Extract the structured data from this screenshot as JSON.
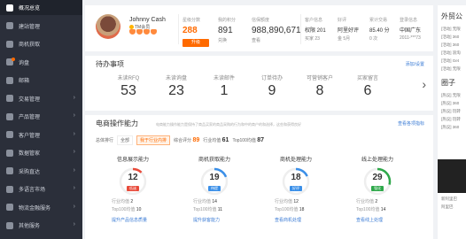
{
  "sidebar": {
    "items": [
      {
        "label": "概况总览",
        "active": true,
        "arrow": false
      },
      {
        "label": "建站管理",
        "active": false,
        "arrow": false
      },
      {
        "label": "商机获取",
        "active": false,
        "arrow": false
      },
      {
        "label": "询盘",
        "active": false,
        "arrow": false,
        "dot": true
      },
      {
        "label": "邮箱",
        "active": false,
        "arrow": false
      },
      {
        "label": "交易管理",
        "active": false,
        "arrow": true
      },
      {
        "label": "产品管理",
        "active": false,
        "arrow": true
      },
      {
        "label": "客户管理",
        "active": false,
        "arrow": true
      },
      {
        "label": "数据管家",
        "active": false,
        "arrow": true
      },
      {
        "label": "采购直达",
        "active": false,
        "arrow": true
      },
      {
        "label": "多语言市场",
        "active": false,
        "arrow": true
      },
      {
        "label": "物流金融服务",
        "active": false,
        "arrow": true
      },
      {
        "label": "其他服务",
        "active": false,
        "arrow": true
      }
    ]
  },
  "profile": {
    "name": "Johnny Cash",
    "vip": "TM会员",
    "stats": [
      {
        "label": "星级分数",
        "value": "288",
        "sub": "",
        "highlight": true
      },
      {
        "label": "我的积分",
        "value": "891",
        "sub": "兑换"
      },
      {
        "label": "信保额度",
        "value": "988,890,671",
        "sub": "查看"
      },
      {
        "label": "客户信息",
        "value": "权限 201",
        "sub": "买家 23"
      },
      {
        "label": "好评",
        "value": "阿里好评",
        "sub": "金 5月"
      },
      {
        "label": "累计交易",
        "value": "85.40 分",
        "sub": "0 次"
      },
      {
        "label": "登录信息",
        "value": "中国广东",
        "sub": "2011-***73"
      }
    ],
    "upgrade_label": "升级"
  },
  "todo": {
    "title": "待办事项",
    "link": "添加/设置",
    "items": [
      {
        "label": "未读RFQ",
        "value": "53"
      },
      {
        "label": "未读询盘",
        "value": "23"
      },
      {
        "label": "未读邮件",
        "value": "1"
      },
      {
        "label": "订单待办",
        "value": "9"
      },
      {
        "label": "可营销客户",
        "value": "8"
      },
      {
        "label": "买家留言",
        "value": "6"
      }
    ]
  },
  "ability": {
    "title": "电商操作能力",
    "desc": "电商能力操作能力是保持了商品买家的商品采购的行为和中的商户的和选择，这些和获得良好",
    "link": "查看各项指标",
    "row_label": "总体排行",
    "chip_all": "全部",
    "chip_peer": "我于行业内排",
    "score_label": "综合评分",
    "score_value": "89",
    "industry_label": "行业均值",
    "industry_value": "61",
    "top100_label": "Top100均值",
    "top100_value": "87",
    "cols": [
      {
        "title": "信息展示能力",
        "value": "12",
        "pct": 0.12,
        "tag": "低迷",
        "color": "#e84a3a",
        "peer": "2",
        "top": "10",
        "link": "提升产品信息质量"
      },
      {
        "title": "商机获取能力",
        "value": "19",
        "pct": 0.19,
        "tag": "待提",
        "color": "#3a8fe8",
        "peer": "14",
        "top": "11",
        "link": "提升获客能力"
      },
      {
        "title": "商机处理能力",
        "value": "18",
        "pct": 0.18,
        "tag": "好评",
        "color": "#3a8fe8",
        "peer": "12",
        "top": "18",
        "link": "查看商机处理"
      },
      {
        "title": "线上处理能力",
        "value": "29",
        "pct": 0.29,
        "tag": "强化",
        "color": "#2ea84a",
        "peer": "2",
        "top": "14",
        "link": "查看线上处理"
      }
    ],
    "peer_label": "行业均值",
    "top_label": "Top100均值"
  },
  "right": {
    "title1": "外贸公",
    "lines1": [
      "[活动] 无限",
      "[活动] 360",
      "[活动] 360",
      "[活动] 浪淘",
      "[活动] Get",
      "[活动] 无限"
    ],
    "title2": "圈子",
    "lines2": [
      "[热议] 无限",
      "[热议] 360",
      "[热议] 玩转",
      "[热议] 玩转",
      "[热议] 360"
    ],
    "title3": "外贸新",
    "lines3": [
      "新客户成",
      "新阿里巴",
      "阿里巴"
    ]
  }
}
